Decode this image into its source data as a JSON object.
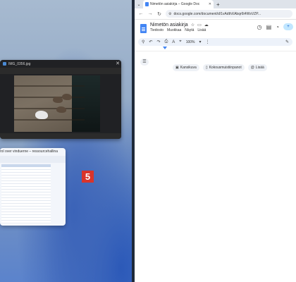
{
  "photo_viewer": {
    "title": "IMG_0356.jpg",
    "close": "✕"
  },
  "sheet_window": {
    "title": "rol over vinduerne – ressourcehallina"
  },
  "badge": "5",
  "browser": {
    "tab": {
      "title": "Nimetön asiakirja – Google Doc",
      "close": "✕",
      "menu": "⌄"
    },
    "new_tab": "+",
    "nav": {
      "back": "←",
      "forward": "→",
      "reload": "↻"
    },
    "url": "docs.google.com/document/d/1vAdthXAbqr6t4WsVZP..."
  },
  "docs": {
    "doc_title": "Nimetön asiakirja",
    "menus": [
      "Tiedosto",
      "Muokkaa",
      "Näytä",
      "Lisää"
    ],
    "zoom": "100%",
    "chips": [
      "Kansikuva",
      "Kokousmuistiinpanot",
      "Lisää"
    ]
  },
  "colors": {
    "docs_blue": "#4285f4",
    "badge_red": "#d9342b",
    "share_bg": "#c2e7ff"
  },
  "icons": {
    "star": "star-icon",
    "move": "folder-move-icon",
    "cloud": "cloud-status-icon",
    "history": "history-icon",
    "comment": "comment-icon",
    "meet": "meet-icon",
    "share": "share-icon"
  }
}
